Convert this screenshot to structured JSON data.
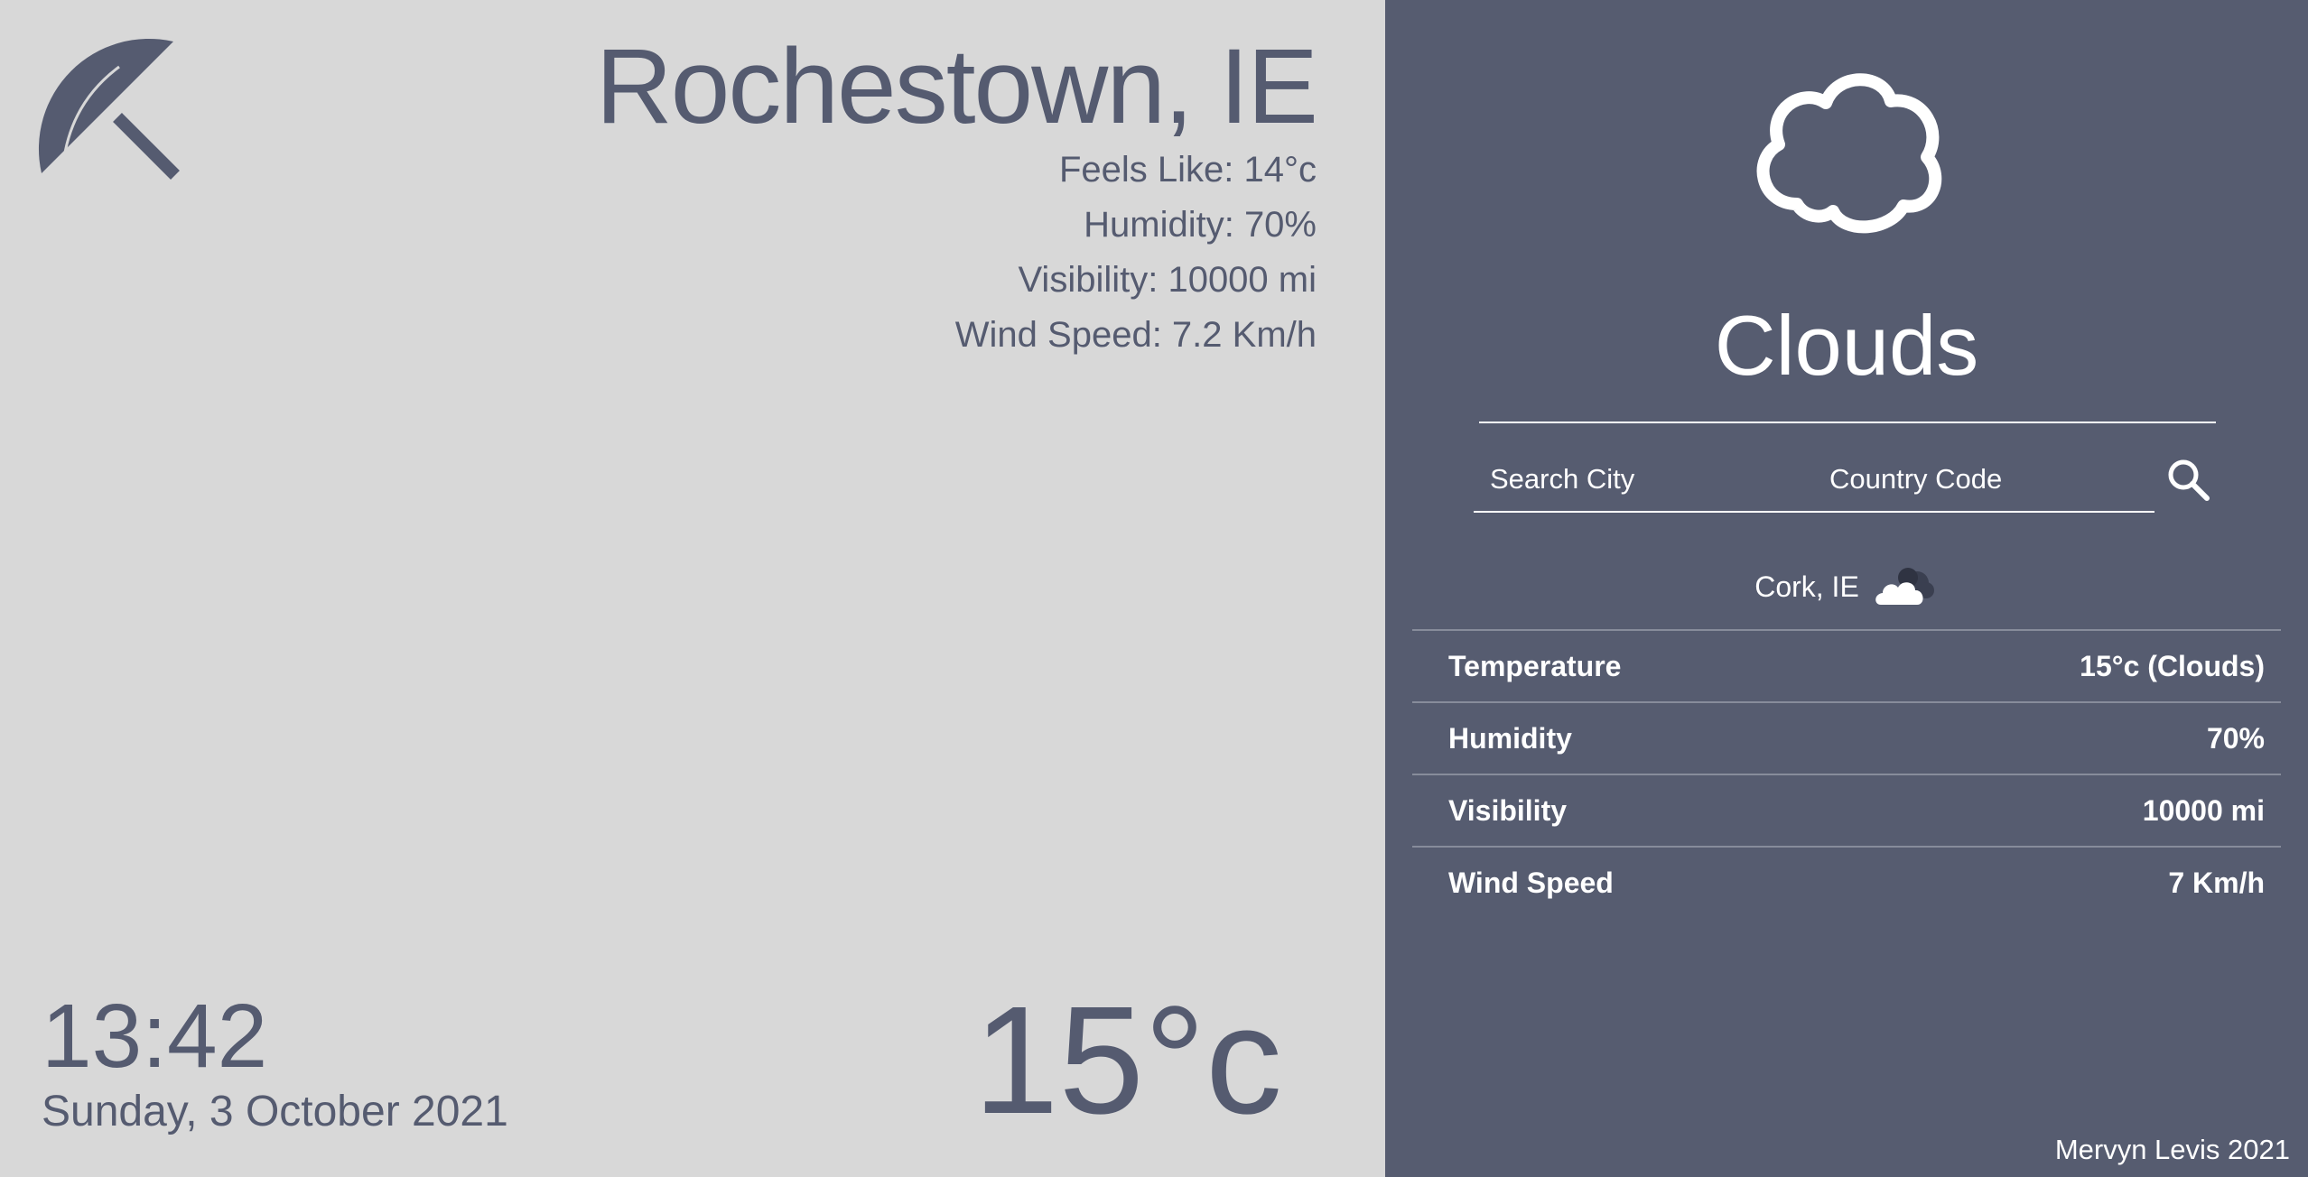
{
  "location": {
    "title": "Rochestown, IE",
    "feels_like": "Feels Like: 14°c",
    "humidity": "Humidity: 70%",
    "visibility": "Visibility: 10000 mi",
    "wind_speed": "Wind Speed: 7.2 Km/h"
  },
  "clock": {
    "time": "13:42",
    "date": "Sunday, 3 October 2021"
  },
  "current_temp": "15°c",
  "condition": "Clouds",
  "search": {
    "city_placeholder": "Search City",
    "country_placeholder": "Country Code",
    "icon": "search-icon"
  },
  "result": {
    "city": "Cork, IE",
    "icon": "cloud-icon",
    "rows": [
      {
        "label": "Temperature",
        "value": "15°c (Clouds)"
      },
      {
        "label": "Humidity",
        "value": "70%"
      },
      {
        "label": "Visibility",
        "value": "10000 mi"
      },
      {
        "label": "Wind Speed",
        "value": "7 Km/h"
      }
    ]
  },
  "footer": {
    "credit": "Mervyn Levis 2021"
  },
  "colors": {
    "left_bg": "#d8d8d8",
    "right_bg": "#565c70",
    "left_text": "#555b70",
    "right_text": "#ffffff"
  },
  "icons": {
    "logo": "umbrella-icon",
    "condition": "cloud-icon"
  }
}
